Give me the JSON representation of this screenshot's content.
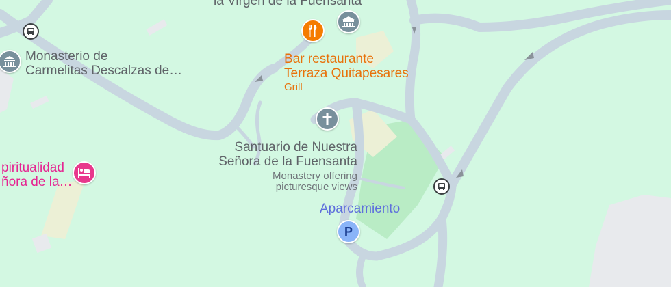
{
  "colors": {
    "land": "#d3f8e2",
    "park": "#b9ecc5",
    "road": "#c8d6e0",
    "road_edge": "#b7c6d1",
    "building": "#e8eaed",
    "sand": "#ecf0d6",
    "gray_pin": "#78909c",
    "orange_pin": "#f57c00",
    "pink_pin": "#e8388c",
    "blue_pin": "#8ab4f8",
    "arrow": "#8a9299"
  },
  "labels": {
    "top_cut": "la Virgen de la Fuensanta",
    "carmelitas": {
      "line1": "Monasterio de",
      "line2": "Carmelitas Descalzas de…"
    },
    "bar": {
      "line1": "Bar restaurante",
      "line2": "Terraza Quitapesares",
      "category": "Grill"
    },
    "santuario": {
      "line1": "Santuario de Nuestra",
      "line2": "Señora de la Fuensanta",
      "desc1": "Monastery offering",
      "desc2": "picturesque views"
    },
    "espiritualidad": {
      "line1": "piritualidad",
      "line2": "ñora de la…"
    },
    "parking": {
      "name": "Aparcamiento",
      "letter": "P"
    }
  },
  "icons": {
    "monument": "monument-icon",
    "restaurant": "fork-knife-icon",
    "church": "cross-icon",
    "hotel": "bed-icon",
    "parking": "parking-icon",
    "bus": "bus-icon",
    "oneway": "direction-arrow-icon"
  }
}
